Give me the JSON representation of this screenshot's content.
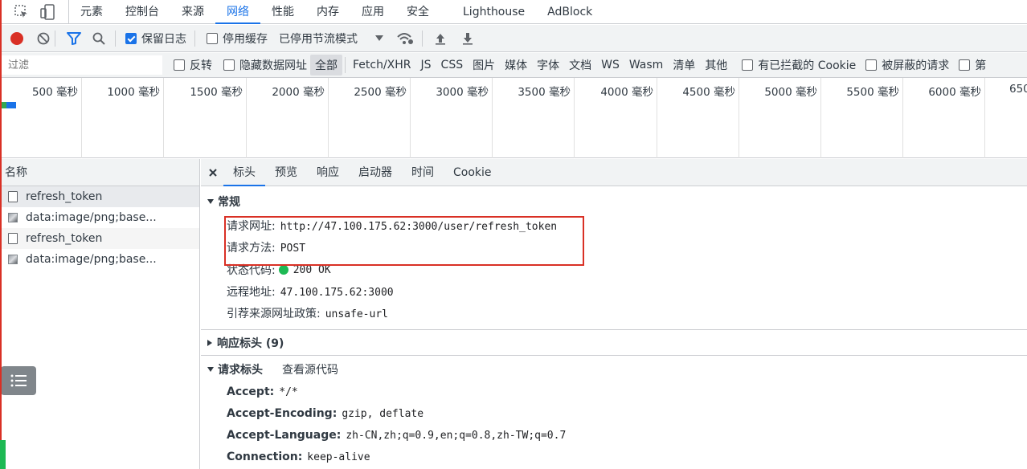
{
  "tabs": [
    "元素",
    "控制台",
    "来源",
    "网络",
    "性能",
    "内存",
    "应用",
    "安全",
    "Lighthouse",
    "AdBlock"
  ],
  "active_tab": "网络",
  "toolbar": {
    "preserve_log": "保留日志",
    "disable_cache": "停用缓存",
    "throttle": "已停用节流模式"
  },
  "filter": {
    "placeholder": "过滤",
    "invert": "反转",
    "hide_data_urls": "隐藏数据网址",
    "types": [
      "全部",
      "Fetch/XHR",
      "JS",
      "CSS",
      "图片",
      "媒体",
      "字体",
      "文档",
      "WS",
      "Wasm",
      "清单",
      "其他"
    ],
    "blocked_cookies": "有已拦截的 Cookie",
    "blocked_requests": "被屏蔽的请求",
    "third_party": "第"
  },
  "timeline": {
    "ticks": [
      "500 毫秒",
      "1000 毫秒",
      "1500 毫秒",
      "2000 毫秒",
      "2500 毫秒",
      "3000 毫秒",
      "3500 毫秒",
      "4000 毫秒",
      "4500 毫秒",
      "5000 毫秒",
      "5500 毫秒",
      "6000 毫秒",
      "650"
    ]
  },
  "left": {
    "header": "名称",
    "requests": [
      "refresh_token",
      "data:image/png;base...",
      "refresh_token",
      "data:image/png;base..."
    ]
  },
  "details": {
    "tabs": [
      "标头",
      "预览",
      "响应",
      "启动器",
      "时间",
      "Cookie"
    ],
    "general": {
      "title": "常规",
      "request_url_label": "请求网址:",
      "request_url": "http://47.100.175.62:3000/user/refresh_token",
      "method_label": "请求方法:",
      "method": "POST",
      "status_label": "状态代码:",
      "status": "200 OK",
      "remote_label": "远程地址:",
      "remote": "47.100.175.62:3000",
      "referrer_label": "引荐来源网址政策:",
      "referrer": "unsafe-url"
    },
    "response_headers": {
      "title": "响应标头 (9)"
    },
    "request_headers": {
      "title": "请求标头",
      "view_source": "查看源代码",
      "items": [
        {
          "k": "Accept:",
          "v": "*/*"
        },
        {
          "k": "Accept-Encoding:",
          "v": "gzip, deflate"
        },
        {
          "k": "Accept-Language:",
          "v": "zh-CN,zh;q=0.9,en;q=0.8,zh-TW;q=0.7"
        },
        {
          "k": "Connection:",
          "v": "keep-alive"
        }
      ]
    }
  },
  "colors": {
    "accent": "#1a73e8",
    "record": "#d93025",
    "highlight": "#d93025",
    "status_ok": "#1db954"
  }
}
